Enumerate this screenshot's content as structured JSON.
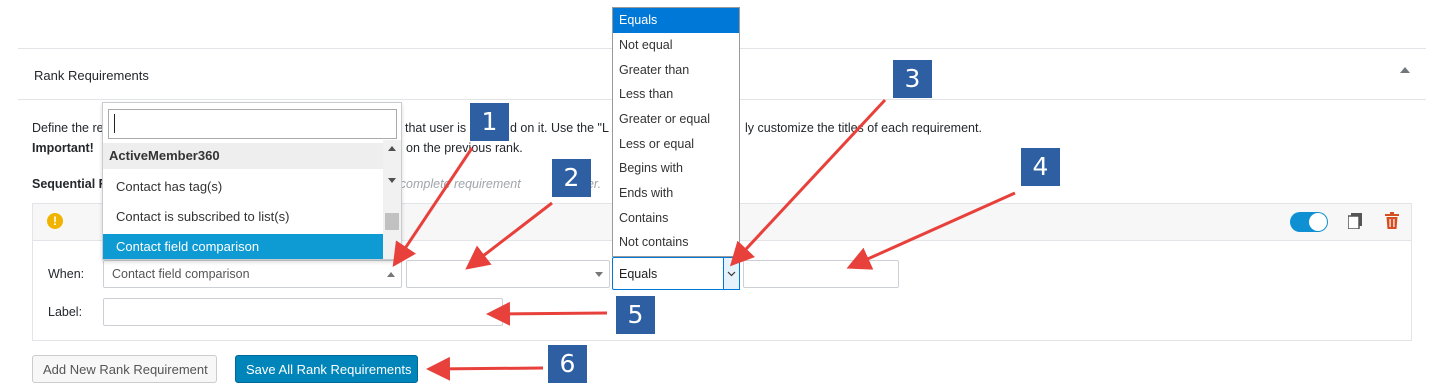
{
  "panel": {
    "title": "Rank Requirements"
  },
  "description": {
    "line1_left": "Define the re",
    "line1_right": " that user is",
    "line1_right2": "d on it. Use the \"L",
    "line1_right3": "ly customize the titles of each requirement.",
    "line2_bold": "Important!",
    "line2_rest": "on the previous rank."
  },
  "sequential": {
    "label": "Sequential R",
    "hint": "rs to complete requirement",
    "hint2": "der."
  },
  "requirement": {
    "when_label": "When:",
    "when_value": "Contact field comparison",
    "label_label": "Label:",
    "label_value": "",
    "operator_value": "Equals",
    "value_input": ""
  },
  "type_dropdown": {
    "search_value": "",
    "group": "ActiveMember360",
    "options": [
      "Contact has tag(s)",
      "Contact is subscribed to list(s)",
      "Contact field comparison"
    ],
    "selected_index": 2
  },
  "operator_dropdown": {
    "options": [
      "Equals",
      "Not equal",
      "Greater than",
      "Less than",
      "Greater or equal",
      "Less or equal",
      "Begins with",
      "Ends with",
      "Contains",
      "Not contains"
    ],
    "selected_index": 0
  },
  "buttons": {
    "add": "Add New Rank Requirement",
    "save": "Save All Rank Requirements"
  },
  "badges": [
    "1",
    "2",
    "3",
    "4",
    "5",
    "6"
  ],
  "colors": {
    "badge": "#2e5fa3",
    "arrow": "#e8413c",
    "primary": "#0085ba",
    "dropdown_selected": "#0e9ad2",
    "native_select_selected": "#0078d7",
    "toggle": "#0e90d2",
    "warning": "#f0b400",
    "trash": "#d54e21"
  },
  "icons": [
    "warning-icon",
    "copy-icon",
    "trash-icon",
    "collapse-icon"
  ]
}
